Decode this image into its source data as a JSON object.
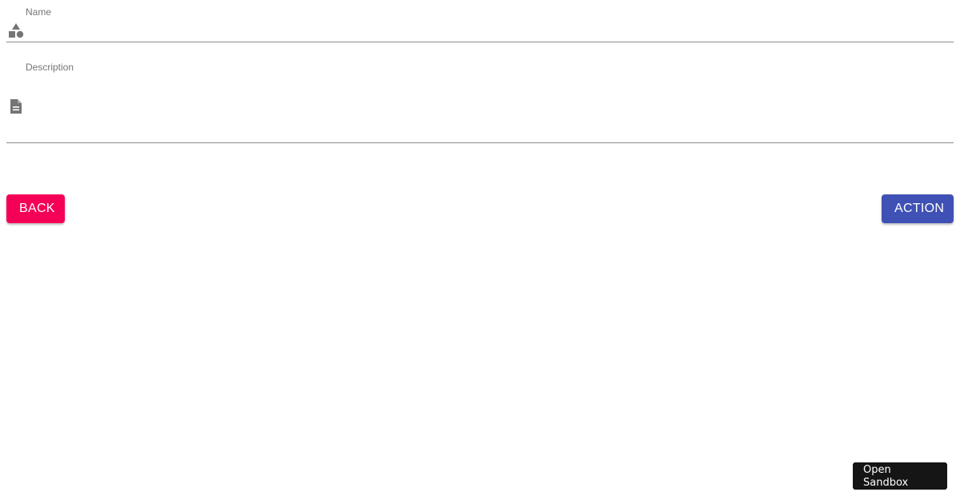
{
  "form": {
    "name_field": {
      "label": "Name",
      "value": "",
      "icon": "category-icon"
    },
    "description_field": {
      "label": "Description",
      "value": "",
      "icon": "description-icon"
    }
  },
  "actions": {
    "back_label": "Back",
    "action_label": "Action",
    "back_color": "#f50057",
    "action_color": "#3f51b5"
  },
  "sandbox": {
    "label": "Open Sandbox"
  }
}
